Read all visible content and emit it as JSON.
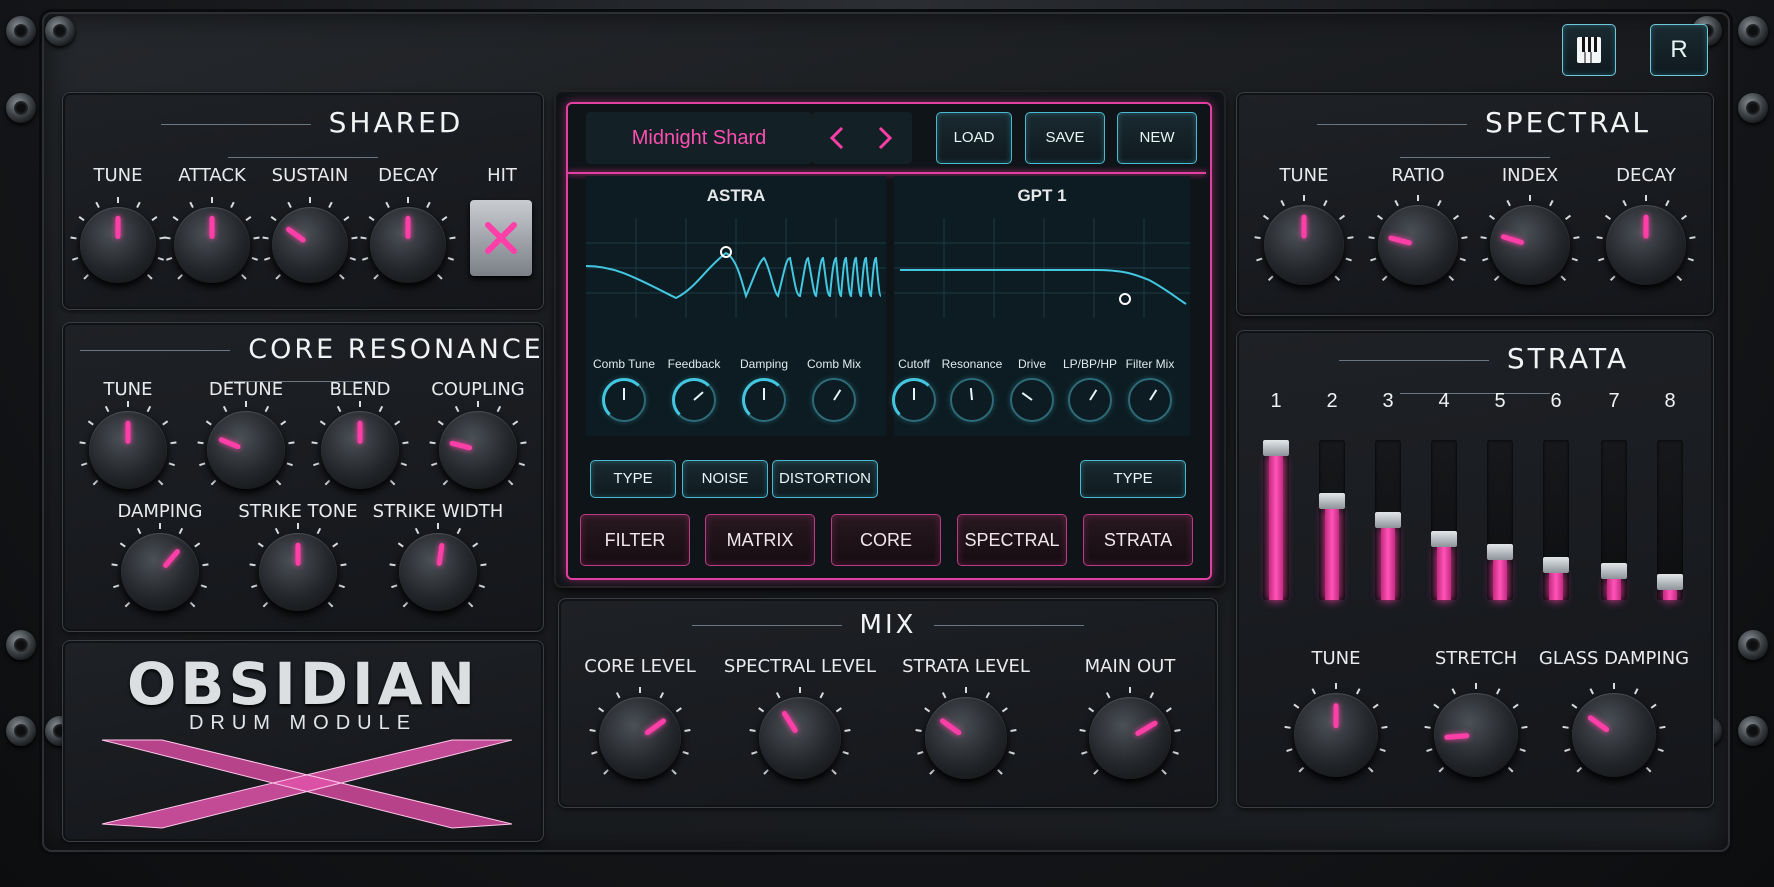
{
  "app": {
    "name": "OBSIDIAN",
    "subtitle": "DRUM MODULE"
  },
  "topbar": {
    "keyboard_icon": "piano-keys-icon",
    "r_label": "R"
  },
  "colors": {
    "accent": "#ff3fa8",
    "cyan": "#43c7e0",
    "panel": "#1a1d21"
  },
  "shared": {
    "title": "SHARED",
    "knobs": [
      {
        "label": "TUNE",
        "value": 0.5
      },
      {
        "label": "ATTACK",
        "value": 0.5
      },
      {
        "label": "SUSTAIN",
        "value": 0.3
      },
      {
        "label": "DECAY",
        "value": 0.5
      }
    ],
    "hit_label": "HIT"
  },
  "core_resonance": {
    "title": "CORE RESONANCE",
    "knobs": [
      {
        "label": "TUNE",
        "value": 0.5
      },
      {
        "label": "DETUNE",
        "value": 0.25
      },
      {
        "label": "BLEND",
        "value": 0.5
      },
      {
        "label": "COUPLING",
        "value": 0.22
      },
      {
        "label": "DAMPING",
        "value": 0.65
      },
      {
        "label": "STRIKE TONE",
        "value": 0.5
      },
      {
        "label": "STRIKE WIDTH",
        "value": 0.53
      }
    ]
  },
  "editor": {
    "preset_name": "Midnight Shard",
    "buttons": [
      "LOAD",
      "SAVE",
      "NEW"
    ],
    "left_display": {
      "title": "ASTRA",
      "knobs": [
        "Comb Tune",
        "Feedback",
        "Damping",
        "Comb Mix"
      ]
    },
    "right_display": {
      "title": "GPT 1",
      "knobs": [
        "Cutoff",
        "Resonance",
        "Drive",
        "LP/BP/HP",
        "Filter Mix"
      ]
    },
    "left_buttons": [
      "TYPE",
      "NOISE",
      "DISTORTION"
    ],
    "right_buttons": [
      "TYPE"
    ],
    "nav_tabs": [
      "FILTER",
      "MATRIX",
      "CORE",
      "SPECTRAL",
      "STRATA"
    ]
  },
  "mix": {
    "title": "MIX",
    "knobs": [
      {
        "label": "CORE LEVEL",
        "value": 0.7
      },
      {
        "label": "SPECTRAL LEVEL",
        "value": 0.38
      },
      {
        "label": "STRATA LEVEL",
        "value": 0.3
      },
      {
        "label": "MAIN OUT",
        "value": 0.72
      }
    ]
  },
  "spectral": {
    "title": "SPECTRAL",
    "knobs": [
      {
        "label": "TUNE",
        "value": 0.5
      },
      {
        "label": "RATIO",
        "value": 0.22
      },
      {
        "label": "INDEX",
        "value": 0.23
      },
      {
        "label": "DECAY",
        "value": 0.5
      }
    ]
  },
  "strata": {
    "title": "STRATA",
    "bands": [
      {
        "num": "1",
        "level": 0.9
      },
      {
        "num": "2",
        "level": 0.57
      },
      {
        "num": "3",
        "level": 0.45
      },
      {
        "num": "4",
        "level": 0.33
      },
      {
        "num": "5",
        "level": 0.25
      },
      {
        "num": "6",
        "level": 0.17
      },
      {
        "num": "7",
        "level": 0.13
      },
      {
        "num": "8",
        "level": 0.06
      }
    ],
    "knobs": [
      {
        "label": "TUNE",
        "value": 0.5
      },
      {
        "label": "STRETCH",
        "value": 0.15
      },
      {
        "label": "GLASS DAMPING",
        "value": 0.3
      }
    ]
  }
}
